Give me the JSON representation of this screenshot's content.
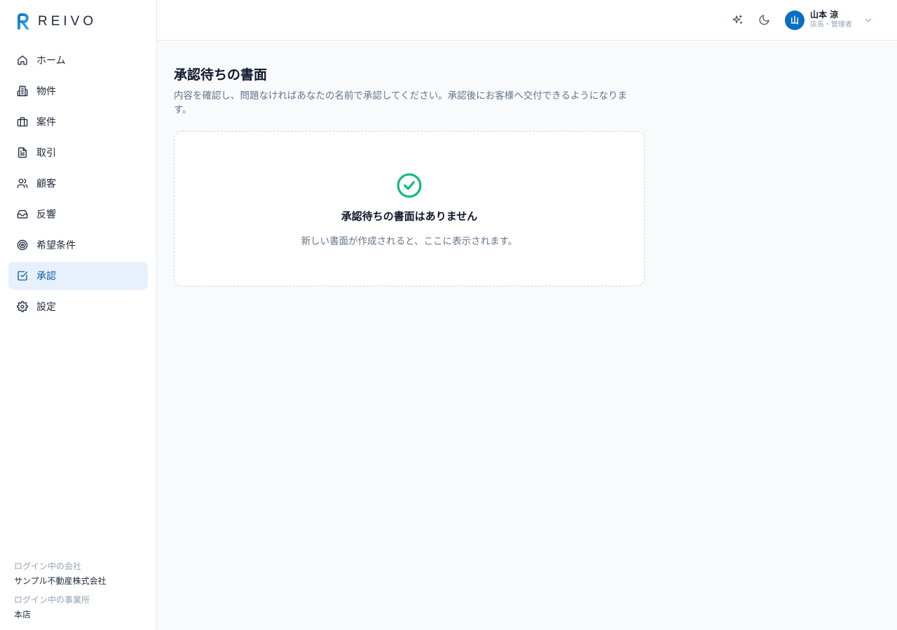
{
  "brand": {
    "name": "REIVO",
    "accent": "#0b6fc1"
  },
  "sidebar": {
    "items": [
      {
        "label": "ホーム",
        "icon": "home-icon",
        "active": false
      },
      {
        "label": "物件",
        "icon": "building-icon",
        "active": false
      },
      {
        "label": "案件",
        "icon": "briefcase-icon",
        "active": false
      },
      {
        "label": "取引",
        "icon": "document-icon",
        "active": false
      },
      {
        "label": "顧客",
        "icon": "users-icon",
        "active": false
      },
      {
        "label": "反響",
        "icon": "inbox-icon",
        "active": false
      },
      {
        "label": "希望条件",
        "icon": "target-icon",
        "active": false
      },
      {
        "label": "承認",
        "icon": "check-square-icon",
        "active": true
      },
      {
        "label": "設定",
        "icon": "gear-icon",
        "active": false
      }
    ],
    "footer": {
      "company_label": "ログイン中の会社",
      "company_value": "サンプル不動産株式会社",
      "office_label": "ログイン中の事業所",
      "office_value": "本店"
    }
  },
  "header": {
    "user": {
      "avatar": "山",
      "name": "山本 涼",
      "role": "店長・管理者"
    }
  },
  "main": {
    "title": "承認待ちの書面",
    "description": "内容を確認し、問題なければあなたの名前で承認してください。承認後にお客様へ交付できるようになります。",
    "empty": {
      "title": "承認待ちの書面はありません",
      "subtitle": "新しい書面が作成されると、ここに表示されます。"
    }
  }
}
